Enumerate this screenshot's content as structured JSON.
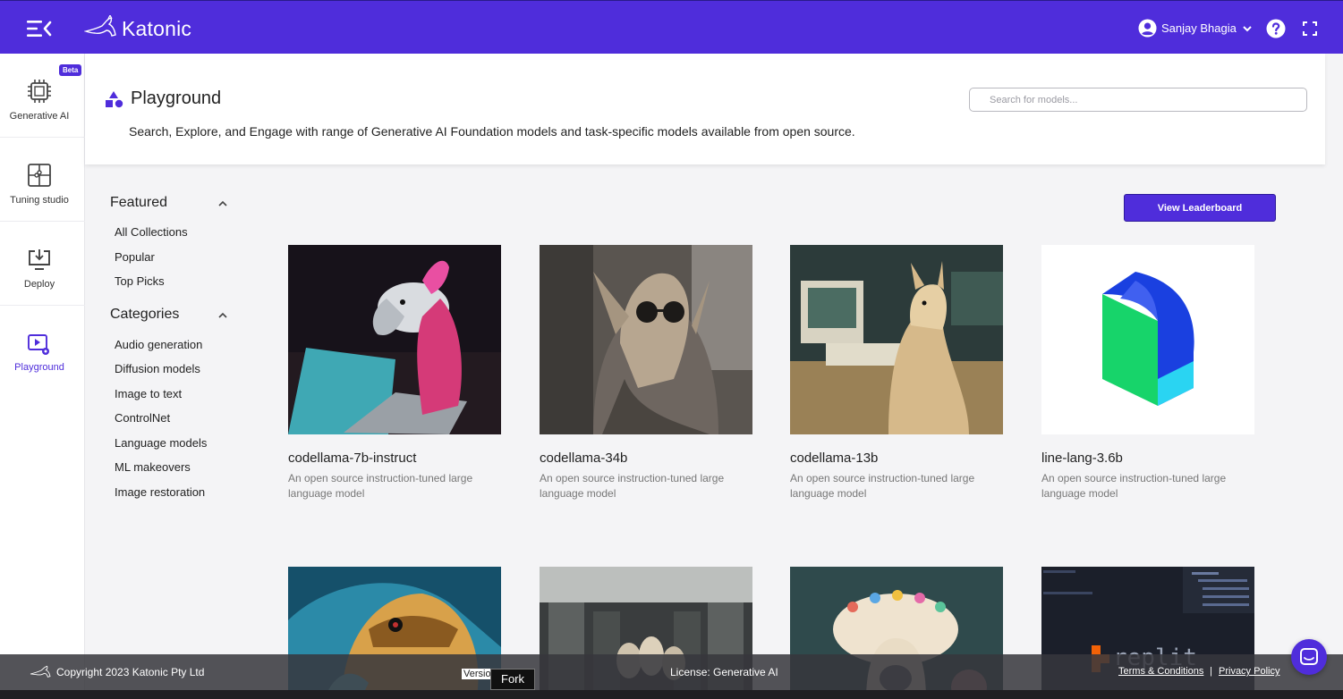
{
  "app": {
    "brand": "Katonic"
  },
  "topbar": {
    "user_name": "Sanjay Bhagia"
  },
  "leftnav": {
    "beta_badge": "Beta",
    "items": [
      {
        "label": "Generative AI",
        "icon": "chip-icon"
      },
      {
        "label": "Tuning studio",
        "icon": "puzzle-icon"
      },
      {
        "label": "Deploy",
        "icon": "deploy-icon"
      },
      {
        "label": "Playground",
        "icon": "playground-icon",
        "active": true
      }
    ]
  },
  "header": {
    "title": "Playground",
    "subtitle": "Search, Explore, and Engage with range of Generative AI Foundation models and task-specific models available from open source.",
    "search_placeholder": "Search for models..."
  },
  "filters": {
    "featured": {
      "heading": "Featured",
      "items": [
        "All Collections",
        "Popular",
        "Top Picks"
      ]
    },
    "categories": {
      "heading": "Categories",
      "items": [
        "Audio generation",
        "Diffusion models",
        "Image to text",
        "ControlNet",
        "Language models",
        "ML makeovers",
        "Image restoration"
      ]
    }
  },
  "leaderboard_label": "View Leaderboard",
  "cards": [
    {
      "title": "codellama-7b-instruct",
      "desc": "An open source instruction-tuned large language model"
    },
    {
      "title": "codellama-34b",
      "desc": "An open source instruction-tuned large language model"
    },
    {
      "title": "codellama-13b",
      "desc": "An open source instruction-tuned large language model"
    },
    {
      "title": "line-lang-3.6b",
      "desc": "An open source instruction-tuned large language model"
    }
  ],
  "footer": {
    "copyright": "Copyright 2023 Katonic Pty Ltd",
    "version": "Version",
    "fork": "Fork",
    "license": "License: Generative AI",
    "terms": "Terms & Conditions",
    "separator": "|",
    "privacy": "Privacy Policy",
    "replit_text": "replit"
  },
  "colors": {
    "accent": "#4f2ddb",
    "background": "#f4f4f6"
  }
}
